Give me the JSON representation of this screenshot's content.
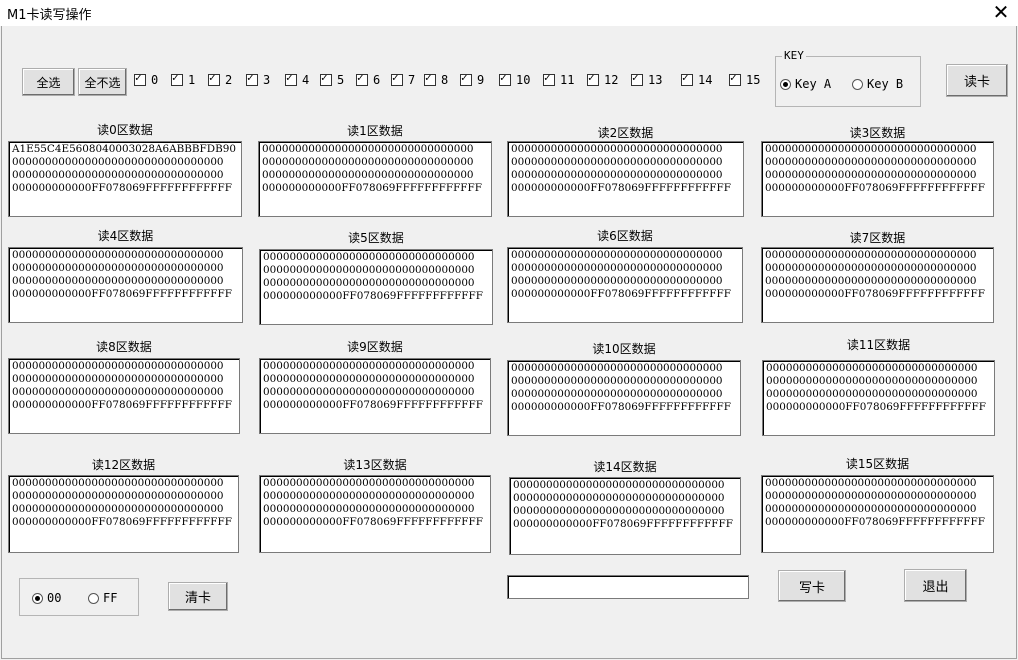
{
  "window": {
    "title": "M1卡读写操作",
    "close_glyph": "✕"
  },
  "toolbar": {
    "select_all": "全选",
    "select_none": "全不选",
    "read_button": "读卡"
  },
  "sector_checks": [
    "0",
    "1",
    "2",
    "3",
    "4",
    "5",
    "6",
    "7",
    "8",
    "9",
    "10",
    "11",
    "12",
    "13",
    "14",
    "15"
  ],
  "key_group": {
    "legend": "KEY",
    "key_a": "Key A",
    "key_b": "Key B",
    "selected": "Key A"
  },
  "sectors": [
    {
      "label": "读0区数据",
      "lines": [
        "A1E55C4E5608040003028A6ABBBFDB90",
        "00000000000000000000000000000000",
        "00000000000000000000000000000000",
        "000000000000FF078069FFFFFFFFFFFF"
      ]
    },
    {
      "label": "读1区数据",
      "lines": [
        "00000000000000000000000000000000",
        "00000000000000000000000000000000",
        "00000000000000000000000000000000",
        "000000000000FF078069FFFFFFFFFFFF"
      ]
    },
    {
      "label": "读2区数据",
      "lines": [
        "00000000000000000000000000000000",
        "00000000000000000000000000000000",
        "00000000000000000000000000000000",
        "000000000000FF078069FFFFFFFFFFFF"
      ]
    },
    {
      "label": "读3区数据",
      "lines": [
        "00000000000000000000000000000000",
        "00000000000000000000000000000000",
        "00000000000000000000000000000000",
        "000000000000FF078069FFFFFFFFFFFF"
      ]
    },
    {
      "label": "读4区数据",
      "lines": [
        "00000000000000000000000000000000",
        "00000000000000000000000000000000",
        "00000000000000000000000000000000",
        "000000000000FF078069FFFFFFFFFFFF"
      ]
    },
    {
      "label": "读5区数据",
      "lines": [
        "00000000000000000000000000000000",
        "00000000000000000000000000000000",
        "00000000000000000000000000000000",
        "000000000000FF078069FFFFFFFFFFFF"
      ]
    },
    {
      "label": "读6区数据",
      "lines": [
        "00000000000000000000000000000000",
        "00000000000000000000000000000000",
        "00000000000000000000000000000000",
        "000000000000FF078069FFFFFFFFFFFF"
      ]
    },
    {
      "label": "读7区数据",
      "lines": [
        "00000000000000000000000000000000",
        "00000000000000000000000000000000",
        "00000000000000000000000000000000",
        "000000000000FF078069FFFFFFFFFFFF"
      ]
    },
    {
      "label": "读8区数据",
      "lines": [
        "00000000000000000000000000000000",
        "00000000000000000000000000000000",
        "00000000000000000000000000000000",
        "000000000000FF078069FFFFFFFFFFFF"
      ]
    },
    {
      "label": "读9区数据",
      "lines": [
        "00000000000000000000000000000000",
        "00000000000000000000000000000000",
        "00000000000000000000000000000000",
        "000000000000FF078069FFFFFFFFFFFF"
      ]
    },
    {
      "label": "读10区数据",
      "lines": [
        "00000000000000000000000000000000",
        "00000000000000000000000000000000",
        "00000000000000000000000000000000",
        "000000000000FF078069FFFFFFFFFFFF"
      ]
    },
    {
      "label": "读11区数据",
      "lines": [
        "00000000000000000000000000000000",
        "00000000000000000000000000000000",
        "00000000000000000000000000000000",
        "000000000000FF078069FFFFFFFFFFFF"
      ]
    },
    {
      "label": "读12区数据",
      "lines": [
        "00000000000000000000000000000000",
        "00000000000000000000000000000000",
        "00000000000000000000000000000000",
        "000000000000FF078069FFFFFFFFFFFF"
      ]
    },
    {
      "label": "读13区数据",
      "lines": [
        "00000000000000000000000000000000",
        "00000000000000000000000000000000",
        "00000000000000000000000000000000",
        "000000000000FF078069FFFFFFFFFFFF"
      ]
    },
    {
      "label": "读14区数据",
      "lines": [
        "00000000000000000000000000000000",
        "00000000000000000000000000000000",
        "00000000000000000000000000000000",
        "000000000000FF078069FFFFFFFFFFFF"
      ]
    },
    {
      "label": "读15区数据",
      "lines": [
        "00000000000000000000000000000000",
        "00000000000000000000000000000000",
        "00000000000000000000000000000000",
        "000000000000FF078069FFFFFFFFFFFF"
      ]
    }
  ],
  "fill_group": {
    "opt_00": "00",
    "opt_ff": "FF",
    "selected": "00"
  },
  "bottom": {
    "clear_button": "清卡",
    "write_input_value": "",
    "write_button": "写卡",
    "exit_button": "退出"
  }
}
